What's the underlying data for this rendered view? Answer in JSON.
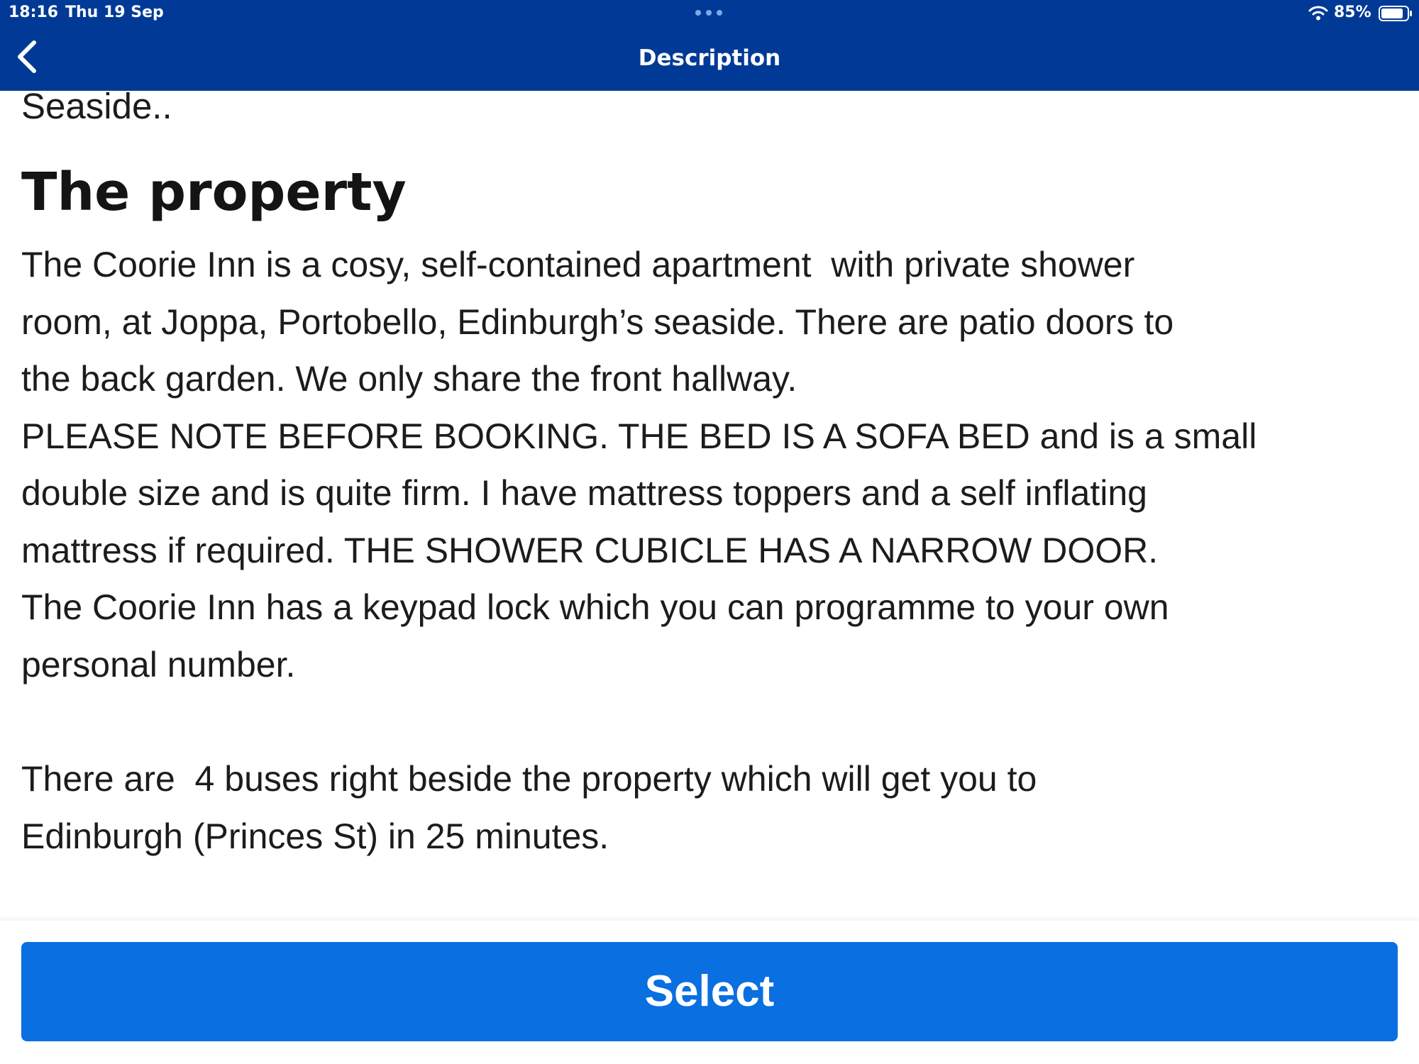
{
  "status_bar": {
    "time": "18:16",
    "date": "Thu 19 Sep",
    "battery": "85%",
    "icons": [
      "wifi-icon",
      "battery-icon",
      "more-dots-icon"
    ]
  },
  "nav": {
    "title": "Description",
    "back_icon": "chevron-left-icon"
  },
  "content": {
    "partial_text": "Seaside..",
    "heading": "The property",
    "paragraph_1": "The Coorie Inn is a cosy, self-contained apartment  with private shower\nroom, at Joppa, Portobello, Edinburgh’s seaside. There are patio doors to\nthe back garden. We only share the front hallway.\nPLEASE NOTE BEFORE BOOKING. THE BED IS A SOFA BED and is a small\ndouble size and is quite firm. I have mattress toppers and a self inflating\nmattress if required. THE SHOWER CUBICLE HAS A NARROW DOOR.\nThe Coorie Inn has a keypad lock which you can programme to your own\npersonal number.",
    "paragraph_2": "There are  4 buses right beside the property which will get you to\nEdinburgh (Princes St) in 25 minutes."
  },
  "footer": {
    "select_label": "Select"
  },
  "colors": {
    "nav_background": "#003a96",
    "button_background": "#0a6fe0",
    "text": "#1c1c1c"
  }
}
